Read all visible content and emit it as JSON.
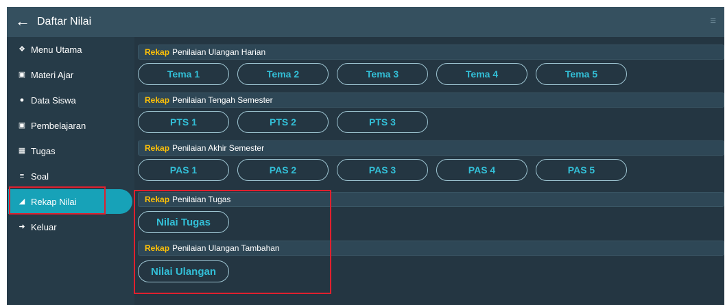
{
  "header": {
    "back_icon": "arrow-left-icon",
    "title": "Daftar Nilai",
    "menu_icon": "hamburger-menu-icon"
  },
  "sidebar": {
    "items": [
      {
        "label": "Menu Utama",
        "icon": "home-icon"
      },
      {
        "label": "Materi Ajar",
        "icon": "chalkboard-icon"
      },
      {
        "label": "Data Siswa",
        "icon": "users-icon"
      },
      {
        "label": "Pembelajaran",
        "icon": "chalkboard-icon"
      },
      {
        "label": "Tugas",
        "icon": "tasks-icon"
      },
      {
        "label": "Soal",
        "icon": "list-icon"
      },
      {
        "label": "Rekap Nilai",
        "icon": "chart-area-icon",
        "active": true
      },
      {
        "label": "Keluar",
        "icon": "sign-out-icon"
      }
    ]
  },
  "sections": [
    {
      "prefix": "Rekap",
      "title": "Penilaian Ulangan Harian",
      "buttons": [
        "Tema 1",
        "Tema 2",
        "Tema 3",
        "Tema 4",
        "Tema 5"
      ]
    },
    {
      "prefix": "Rekap",
      "title": "Penilaian Tengah Semester",
      "buttons": [
        "PTS 1",
        "PTS 2",
        "PTS 3"
      ]
    },
    {
      "prefix": "Rekap",
      "title": "Penilaian Akhir Semester",
      "buttons": [
        "PAS 1",
        "PAS 2",
        "PAS 3",
        "PAS 4",
        "PAS 5"
      ]
    },
    {
      "prefix": "Rekap",
      "title": "Penilaian Tugas",
      "buttons": [
        "Nilai Tugas"
      ]
    },
    {
      "prefix": "Rekap",
      "title": "Penilaian Ulangan Tambahan",
      "buttons": [
        "Nilai Ulangan"
      ]
    }
  ],
  "colors": {
    "accent": "#17a2b8",
    "highlight": "#ffc107",
    "annotation": "#e0202e"
  }
}
